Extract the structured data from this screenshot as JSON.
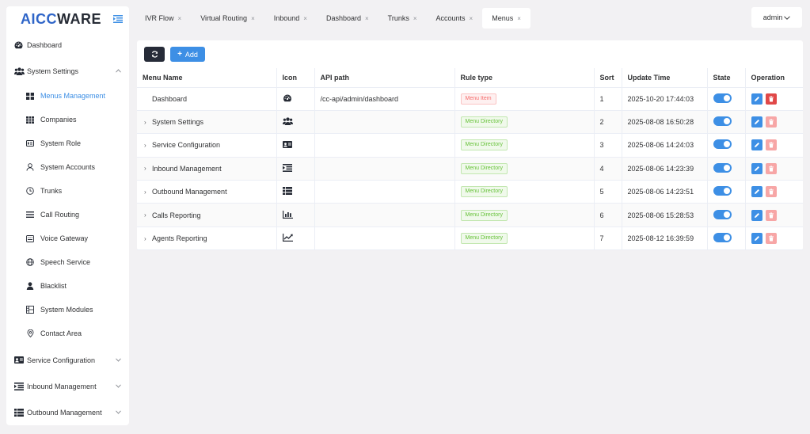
{
  "logo": {
    "part1": "AICC",
    "part2": "WARE"
  },
  "sidebar": {
    "top_items": [
      {
        "label": "Dashboard",
        "icon": "dashboard-icon"
      },
      {
        "label": "System Settings",
        "icon": "users-icon",
        "expanded": true
      }
    ],
    "sub_items": [
      {
        "label": "Menus Management",
        "icon": "grid-icon",
        "active": true
      },
      {
        "label": "Companies",
        "icon": "table-icon"
      },
      {
        "label": "System Role",
        "icon": "id-card-icon"
      },
      {
        "label": "System Accounts",
        "icon": "user-icon"
      },
      {
        "label": "Trunks",
        "icon": "clock-icon"
      },
      {
        "label": "Call Routing",
        "icon": "list-icon"
      },
      {
        "label": "Voice Gateway",
        "icon": "keyboard-icon"
      },
      {
        "label": "Speech Service",
        "icon": "globe-icon"
      },
      {
        "label": "Blacklist",
        "icon": "person-icon"
      },
      {
        "label": "System Modules",
        "icon": "module-icon"
      },
      {
        "label": "Contact Area",
        "icon": "location-icon"
      }
    ],
    "bottom_items": [
      {
        "label": "Service Configuration",
        "icon": "id-card-icon"
      },
      {
        "label": "Inbound Management",
        "icon": "indent-icon"
      },
      {
        "label": "Outbound Management",
        "icon": "list-icon"
      }
    ]
  },
  "tabs": [
    {
      "label": "IVR Flow",
      "close": "×"
    },
    {
      "label": "Virtual Routing",
      "close": "×"
    },
    {
      "label": "Inbound",
      "close": "×"
    },
    {
      "label": "Dashboard",
      "close": "×"
    },
    {
      "label": "Trunks",
      "close": "×"
    },
    {
      "label": "Accounts",
      "close": "×"
    },
    {
      "label": "Menus",
      "close": "×",
      "active": true
    }
  ],
  "user": {
    "name": "admin"
  },
  "toolbar": {
    "add_label": "Add",
    "add_plus": "+"
  },
  "table": {
    "columns": [
      "Menu Name",
      "Icon",
      "API path",
      "Rule type",
      "Sort",
      "Update Time",
      "State",
      "Operation"
    ],
    "rows": [
      {
        "name": "Dashboard",
        "icon": "dashboard-icon",
        "api_path": "/cc-api/admin/dashboard",
        "rule_type": "Menu Item",
        "sort": "1",
        "update_time": "2025-10-20 17:44:03",
        "expandable": false
      },
      {
        "name": "System Settings",
        "icon": "users-icon",
        "api_path": "",
        "rule_type": "Menu Directory",
        "sort": "2",
        "update_time": "2025-08-08 16:50:28",
        "expandable": true
      },
      {
        "name": "Service Configuration",
        "icon": "id-card-icon",
        "api_path": "",
        "rule_type": "Menu Directory",
        "sort": "3",
        "update_time": "2025-08-06 14:24:03",
        "expandable": true
      },
      {
        "name": "Inbound Management",
        "icon": "indent-icon",
        "api_path": "",
        "rule_type": "Menu Directory",
        "sort": "4",
        "update_time": "2025-08-06 14:23:39",
        "expandable": true
      },
      {
        "name": "Outbound Management",
        "icon": "list-icon",
        "api_path": "",
        "rule_type": "Menu Directory",
        "sort": "5",
        "update_time": "2025-08-06 14:23:51",
        "expandable": true
      },
      {
        "name": "Calls Reporting",
        "icon": "bar-chart-icon",
        "api_path": "",
        "rule_type": "Menu Directory",
        "sort": "6",
        "update_time": "2025-08-06 15:28:53",
        "expandable": true
      },
      {
        "name": "Agents Reporting",
        "icon": "line-chart-icon",
        "api_path": "",
        "rule_type": "Menu Directory",
        "sort": "7",
        "update_time": "2025-08-12 16:39:59",
        "expandable": true
      }
    ],
    "expand_glyph": "›"
  },
  "colors": {
    "primary": "#3d8fe5",
    "danger": "#e04848",
    "success": "#67c23a",
    "dark": "#262b38"
  }
}
